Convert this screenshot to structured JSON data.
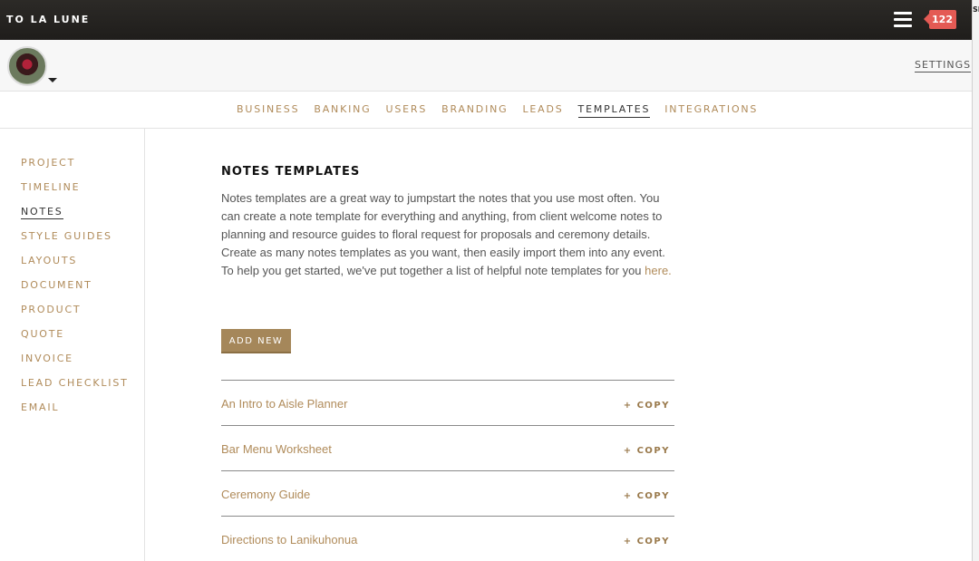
{
  "topbar": {
    "brand": "TO LA LUNE",
    "notification_count": "122",
    "edge_text": "SI"
  },
  "subheader": {
    "settings_label": "SETTINGS"
  },
  "tabs": [
    {
      "label": "BUSINESS",
      "active": false
    },
    {
      "label": "BANKING",
      "active": false
    },
    {
      "label": "USERS",
      "active": false
    },
    {
      "label": "BRANDING",
      "active": false
    },
    {
      "label": "LEADS",
      "active": false
    },
    {
      "label": "TEMPLATES",
      "active": true
    },
    {
      "label": "INTEGRATIONS",
      "active": false
    }
  ],
  "sidebar": {
    "items": [
      {
        "label": "PROJECT",
        "active": false
      },
      {
        "label": "TIMELINE",
        "active": false
      },
      {
        "label": "NOTES",
        "active": true
      },
      {
        "label": "STYLE GUIDES",
        "active": false
      },
      {
        "label": "LAYOUTS",
        "active": false
      },
      {
        "label": "DOCUMENT",
        "active": false
      },
      {
        "label": "PRODUCT",
        "active": false
      },
      {
        "label": "QUOTE",
        "active": false
      },
      {
        "label": "INVOICE",
        "active": false
      },
      {
        "label": "LEAD CHECKLIST",
        "active": false
      },
      {
        "label": "EMAIL",
        "active": false
      }
    ]
  },
  "main": {
    "title": "NOTES TEMPLATES",
    "description": "Notes templates are a great way to jumpstart the notes that you use most often. You can create a note template for everything and anything, from client welcome notes to planning and resource guides to floral request for proposals and ceremony details. Create as many notes templates as you want, then easily import them into any event. To help you get started, we've put together a list of helpful note templates for you ",
    "description_link": "here.",
    "add_button_label": "ADD NEW",
    "copy_label": "+ COPY",
    "templates": [
      {
        "name": "An Intro to Aisle Planner"
      },
      {
        "name": "Bar Menu Worksheet"
      },
      {
        "name": "Ceremony Guide"
      },
      {
        "name": "Directions to Lanikuhonua"
      }
    ]
  },
  "colors": {
    "accent": "#b08b5a",
    "button": "#a5875a",
    "badge": "#e45a54",
    "topbar": "#2c2a27"
  },
  "icons": {
    "menu": "hamburger-menu-icon",
    "avatar_caret": "caret-down-icon"
  }
}
